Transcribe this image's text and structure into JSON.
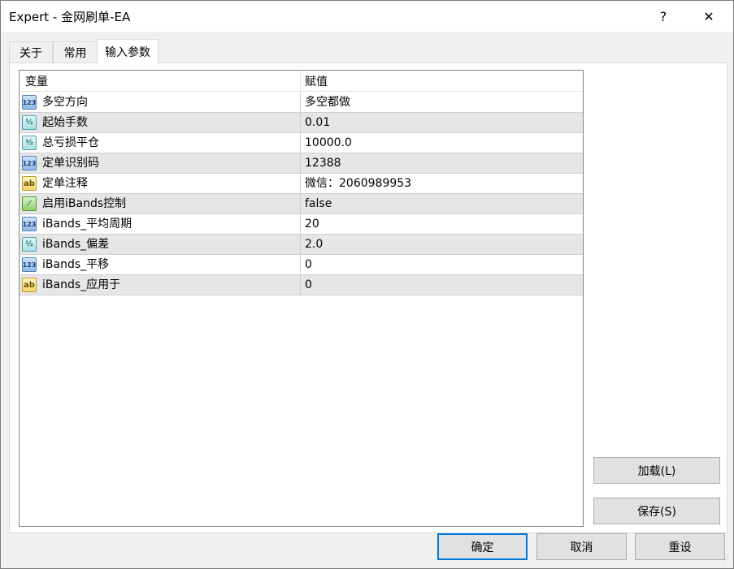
{
  "window": {
    "title": "Expert - 金网刷单-EA",
    "help_label": "?",
    "close_label": "✕"
  },
  "tabs": [
    {
      "label": "关于"
    },
    {
      "label": "常用"
    },
    {
      "label": "输入参数"
    }
  ],
  "active_tab": 2,
  "grid": {
    "headers": {
      "variable": "变量",
      "value": "赋值"
    },
    "rows": [
      {
        "icon": "int-type-icon",
        "icon_text": "123",
        "type": "int",
        "name": "多空方向",
        "value": "多空都做"
      },
      {
        "icon": "double-type-icon",
        "icon_text": "½",
        "type": "dbl",
        "name": "起始手数",
        "value": "0.01"
      },
      {
        "icon": "double-type-icon",
        "icon_text": "½",
        "type": "dbl",
        "name": "总亏损平仓",
        "value": "10000.0"
      },
      {
        "icon": "int-type-icon",
        "icon_text": "123",
        "type": "int",
        "name": "定单识别码",
        "value": "12388"
      },
      {
        "icon": "string-type-icon",
        "icon_text": "ab",
        "type": "str",
        "name": "定单注释",
        "value": "微信：2060989953"
      },
      {
        "icon": "bool-type-icon",
        "icon_text": "⟋",
        "type": "bool",
        "name": "启用iBands控制",
        "value": "false"
      },
      {
        "icon": "int-type-icon",
        "icon_text": "123",
        "type": "int",
        "name": "iBands_平均周期",
        "value": "20"
      },
      {
        "icon": "double-type-icon",
        "icon_text": "½",
        "type": "dbl",
        "name": "iBands_偏差",
        "value": "2.0"
      },
      {
        "icon": "int-type-icon",
        "icon_text": "123",
        "type": "int",
        "name": "iBands_平移",
        "value": "0"
      },
      {
        "icon": "string-type-icon",
        "icon_text": "ab",
        "type": "str",
        "name": "iBands_应用于",
        "value": "0"
      }
    ]
  },
  "buttons": {
    "load": "加载(L)",
    "save": "保存(S)",
    "ok": "确定",
    "cancel": "取消",
    "reset": "重设"
  }
}
